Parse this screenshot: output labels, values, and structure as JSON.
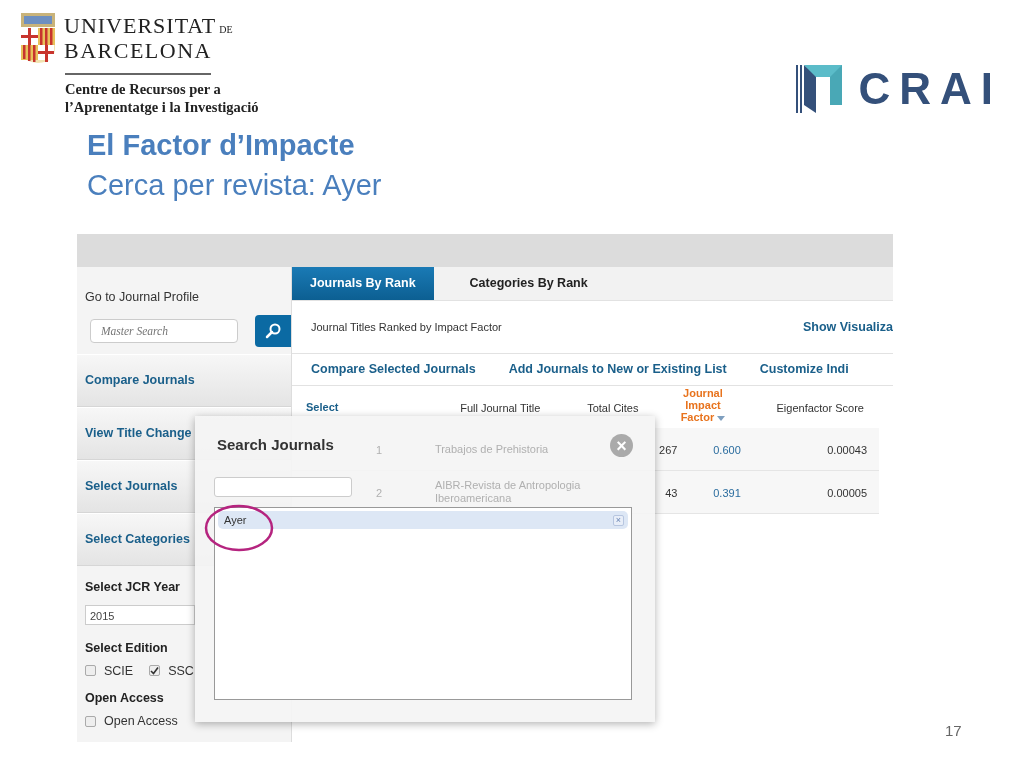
{
  "header": {
    "university": {
      "name_top": "UNIVERSITAT",
      "name_top_suffix": "DE",
      "name_bottom": "BARCELONA"
    },
    "centre_lines": [
      "Centre de Recursos per a",
      "l’Aprenentatge i la Investigació"
    ],
    "brand_logo_text": "CRAI"
  },
  "slide": {
    "title": "El Factor d’Impacte",
    "subtitle": "Cerca per revista: Ayer",
    "page_number": "17"
  },
  "app": {
    "sidebar": {
      "profile_label": "Go to Journal Profile",
      "search_placeholder": "Master Search",
      "menu_items": [
        {
          "label": "Compare Journals"
        },
        {
          "label": "View Title Change"
        },
        {
          "label": "Select Journals"
        },
        {
          "label": "Select Categories"
        }
      ],
      "year_label": "Select JCR Year",
      "year_value": "2015",
      "edition_label": "Select Edition",
      "editions": [
        {
          "label": "SCIE",
          "checked": false
        },
        {
          "label": "SSC",
          "checked": true
        }
      ],
      "open_access_label": "Open Access",
      "open_access_options": [
        {
          "label": "Open Access",
          "checked": false
        }
      ]
    },
    "tabs": [
      {
        "label": "Journals By Rank",
        "selected": true
      },
      {
        "label": "Categories By Rank",
        "selected": false
      }
    ],
    "caption": "Journal Titles Ranked by Impact Factor",
    "visualization_link": "Show Visualiza",
    "actions": [
      "Compare Selected Journals",
      "Add Journals to New or Existing List",
      "Customize Indi"
    ],
    "table": {
      "columns": [
        {
          "label": "Select",
          "sorted": false
        },
        {
          "label": "Full Journal Title",
          "sorted": false
        },
        {
          "label": "Total Cites",
          "sorted": false
        },
        {
          "label": "Journal Impact Factor",
          "sorted": true
        },
        {
          "label": "Eigenfactor Score",
          "sorted": false
        }
      ],
      "rows": [
        [
          "1",
          "Trabajos de Prehistoria",
          "267",
          "0.600",
          "0.00043"
        ],
        [
          "2",
          "AIBR-Revista de Antropologia Iberoamericana",
          "43",
          "0.391",
          "0.00005"
        ]
      ]
    },
    "modal": {
      "title": "Search Journals",
      "close_symbol": "×",
      "selected_journals": [
        {
          "label": "Ayer",
          "remove_symbol": "×"
        }
      ]
    }
  }
}
